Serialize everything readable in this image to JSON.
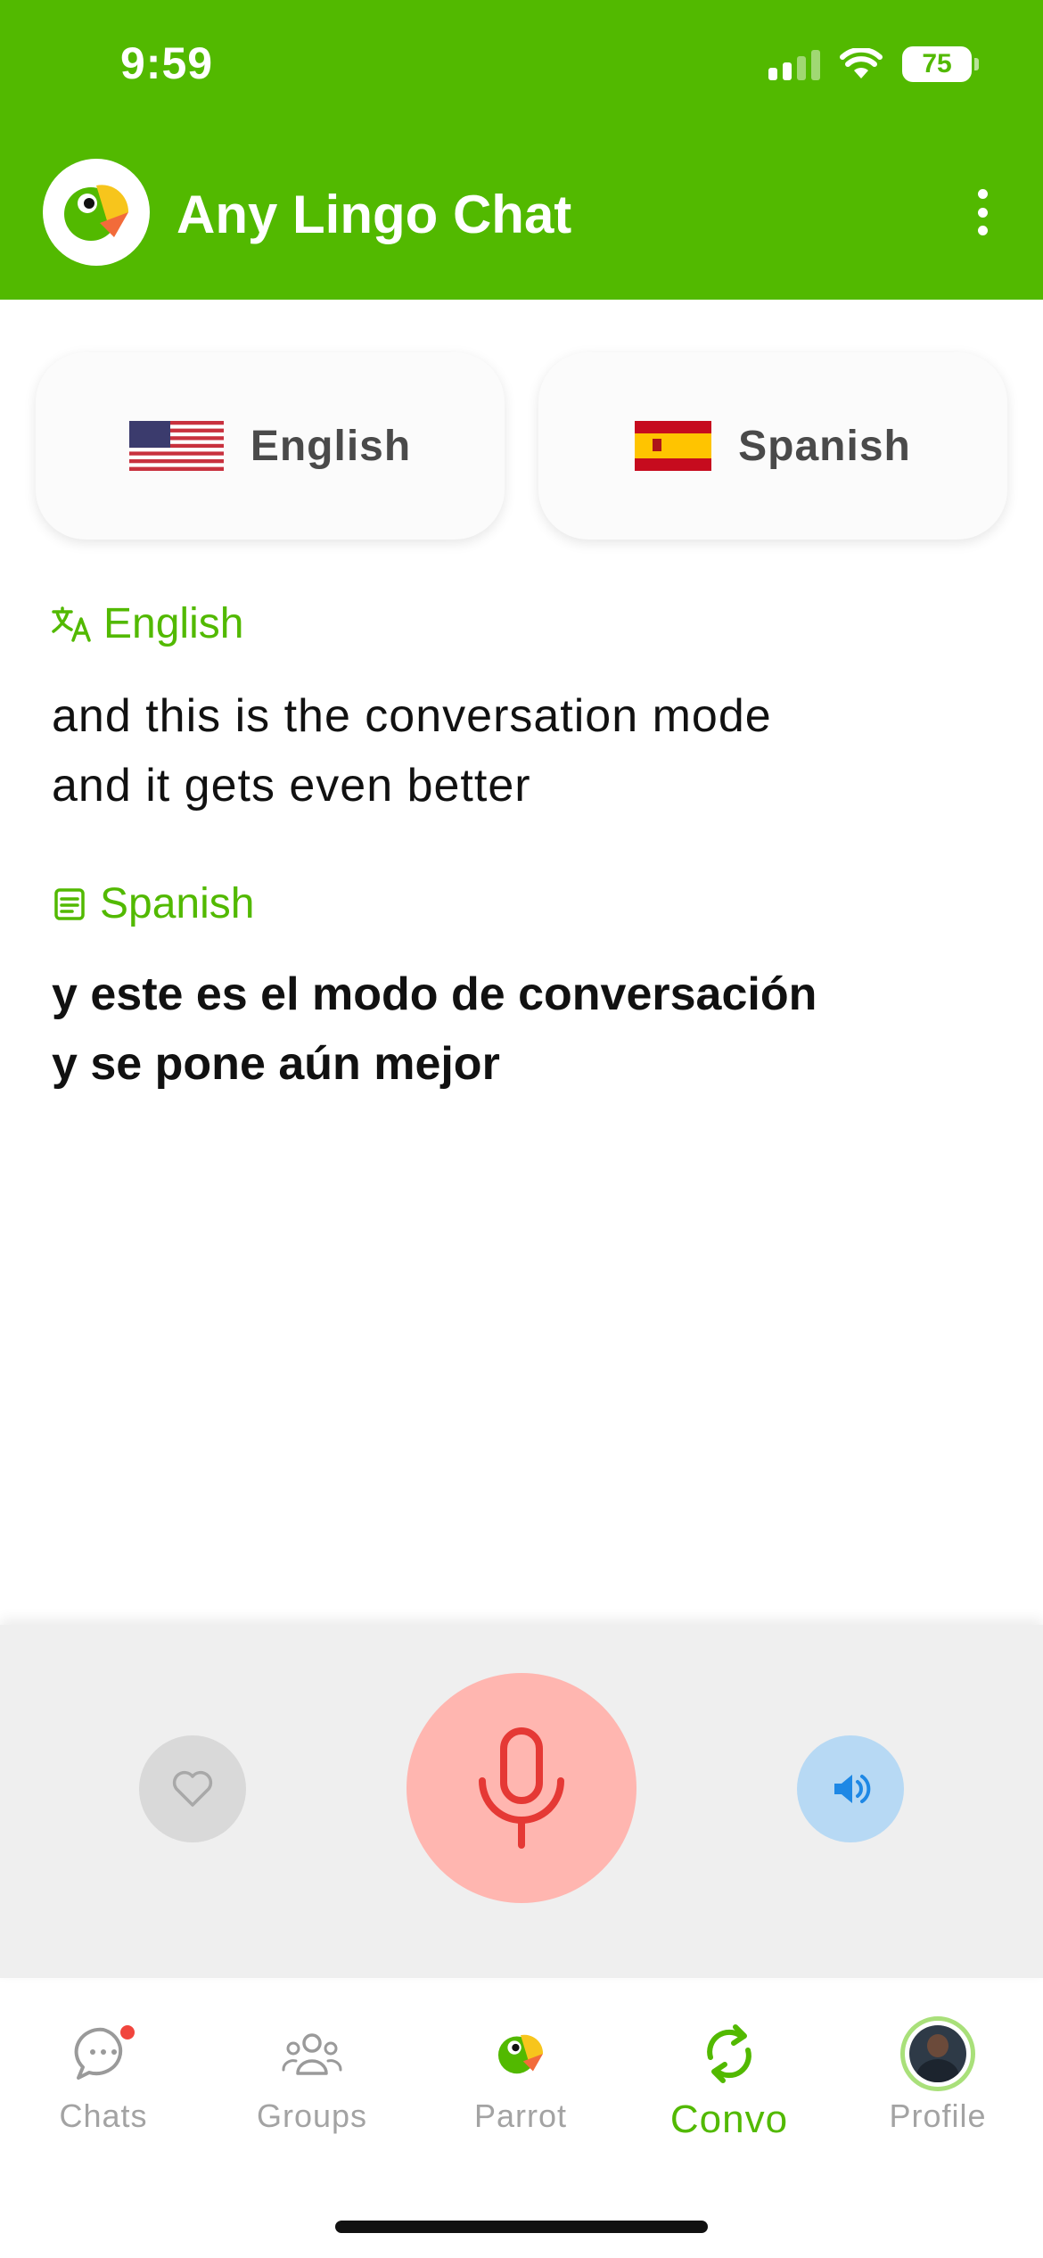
{
  "status_bar": {
    "time": "9:59",
    "battery": "75"
  },
  "header": {
    "title": "Any Lingo Chat",
    "menu_icon": "more-vertical-icon"
  },
  "languages": {
    "source": {
      "name": "English",
      "flag": "us-flag-icon"
    },
    "target": {
      "name": "Spanish",
      "flag": "spain-flag-icon"
    }
  },
  "conversation": {
    "source": {
      "label": "English",
      "icon": "translate-icon",
      "lines": [
        "and this is the conversation mode",
        "and it gets even better"
      ]
    },
    "target": {
      "label": "Spanish",
      "icon": "document-icon",
      "lines": [
        "y este es el modo de conversación",
        "y se pone aún mejor"
      ]
    }
  },
  "controls": {
    "favorite_icon": "heart-icon",
    "mic_icon": "microphone-icon",
    "speaker_icon": "speaker-icon"
  },
  "nav": {
    "items": [
      {
        "label": "Chats",
        "icon": "chat-bubble-icon",
        "badge": true
      },
      {
        "label": "Groups",
        "icon": "groups-icon"
      },
      {
        "label": "Parrot",
        "icon": "parrot-icon"
      },
      {
        "label": "Convo",
        "icon": "sync-icon",
        "active": true
      },
      {
        "label": "Profile",
        "icon": "avatar"
      }
    ]
  },
  "colors": {
    "brand_green": "#52b900",
    "mic_red": "#e53935",
    "speaker_blue": "#1e88e5",
    "badge_red": "#f1453d"
  }
}
